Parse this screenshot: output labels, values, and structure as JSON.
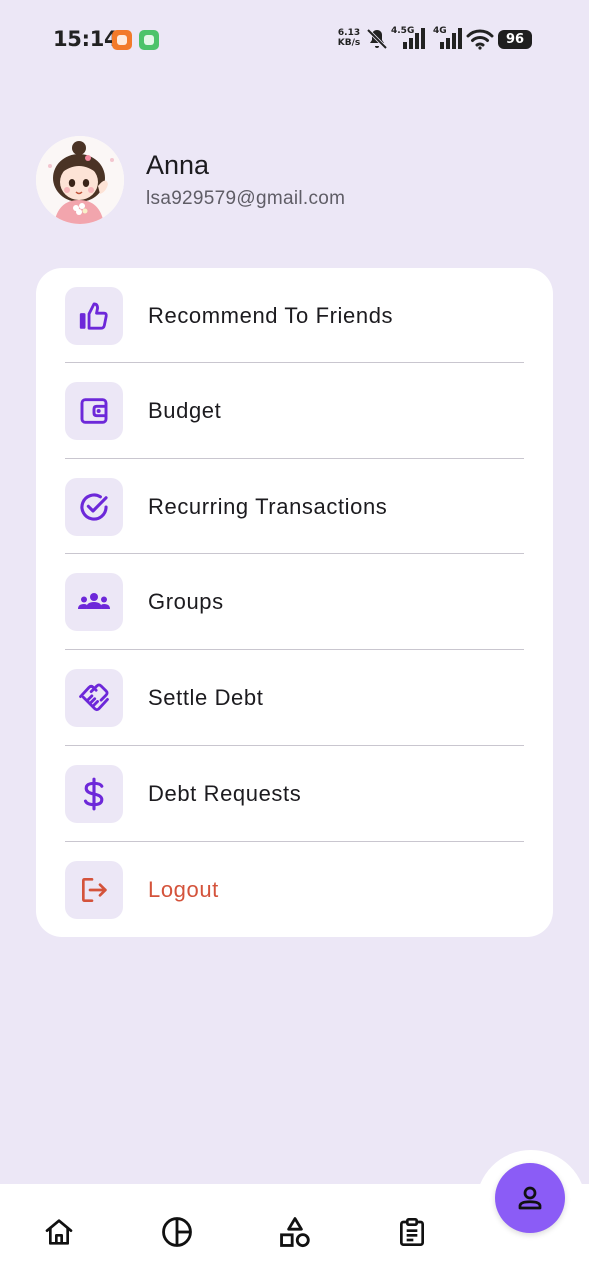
{
  "status_bar": {
    "time": "15:14",
    "net_speed_value": "6.13",
    "net_speed_unit": "KB/s",
    "signal_1_tag": "4.5G",
    "signal_2_tag": "4G",
    "battery": "96"
  },
  "profile": {
    "name": "Anna",
    "email": "lsa929579@gmail.com"
  },
  "menu": {
    "items": [
      {
        "label": "Recommend To Friends",
        "icon": "thumbs-up-icon"
      },
      {
        "label": "Budget",
        "icon": "wallet-icon"
      },
      {
        "label": "Recurring Transactions",
        "icon": "check-circle-icon"
      },
      {
        "label": "Groups",
        "icon": "group-icon"
      },
      {
        "label": "Settle Debt",
        "icon": "handshake-icon"
      },
      {
        "label": "Debt Requests",
        "icon": "dollar-icon"
      },
      {
        "label": "Logout",
        "icon": "logout-icon"
      }
    ]
  },
  "bottom_nav": {
    "items": [
      {
        "icon": "home-icon"
      },
      {
        "icon": "pie-chart-icon"
      },
      {
        "icon": "shapes-icon"
      },
      {
        "icon": "clipboard-icon"
      }
    ],
    "fab_icon": "profile-icon"
  },
  "colors": {
    "background": "#ECE7F6",
    "accent": "#6D28D9",
    "fab": "#8B5CF6",
    "logout": "#D4533B",
    "card": "#FFFFFF"
  }
}
